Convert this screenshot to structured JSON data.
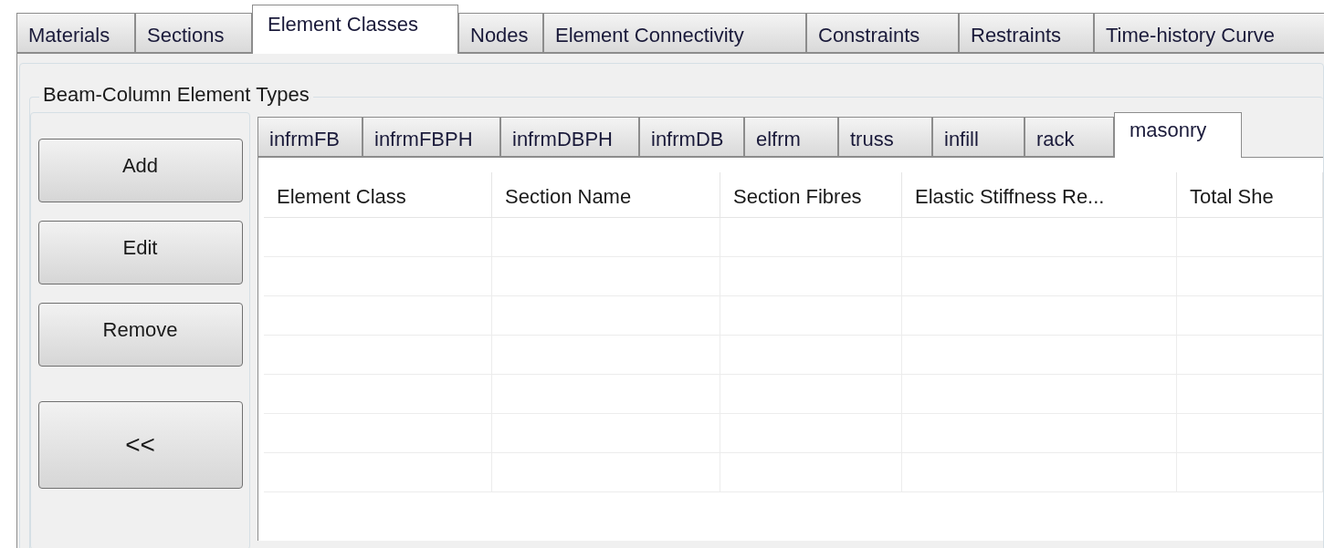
{
  "main_tabs": [
    {
      "label": "Materials",
      "selected": false
    },
    {
      "label": "Sections",
      "selected": false
    },
    {
      "label": "Element Classes",
      "selected": true
    },
    {
      "label": "Nodes",
      "selected": false
    },
    {
      "label": "Element Connectivity",
      "selected": false
    },
    {
      "label": "Constraints",
      "selected": false
    },
    {
      "label": "Restraints",
      "selected": false
    },
    {
      "label": "Time-history Curve",
      "selected": false
    }
  ],
  "group": {
    "title": "Beam-Column Element Types",
    "buttons": [
      "Add",
      "Edit",
      "Remove",
      "<<"
    ],
    "type_tabs": [
      {
        "label": "infrmFB",
        "selected": false
      },
      {
        "label": "infrmFBPH",
        "selected": false
      },
      {
        "label": "infrmDBPH",
        "selected": false
      },
      {
        "label": "infrmDB",
        "selected": false
      },
      {
        "label": "elfrm",
        "selected": false
      },
      {
        "label": "truss",
        "selected": false
      },
      {
        "label": "infill",
        "selected": false
      },
      {
        "label": "rack",
        "selected": false
      },
      {
        "label": "masonry",
        "selected": true
      }
    ],
    "table": {
      "columns": [
        "Element Class",
        "Section Name",
        "Section Fibres",
        "Elastic Stiffness Re...",
        "Total She"
      ]
    }
  }
}
